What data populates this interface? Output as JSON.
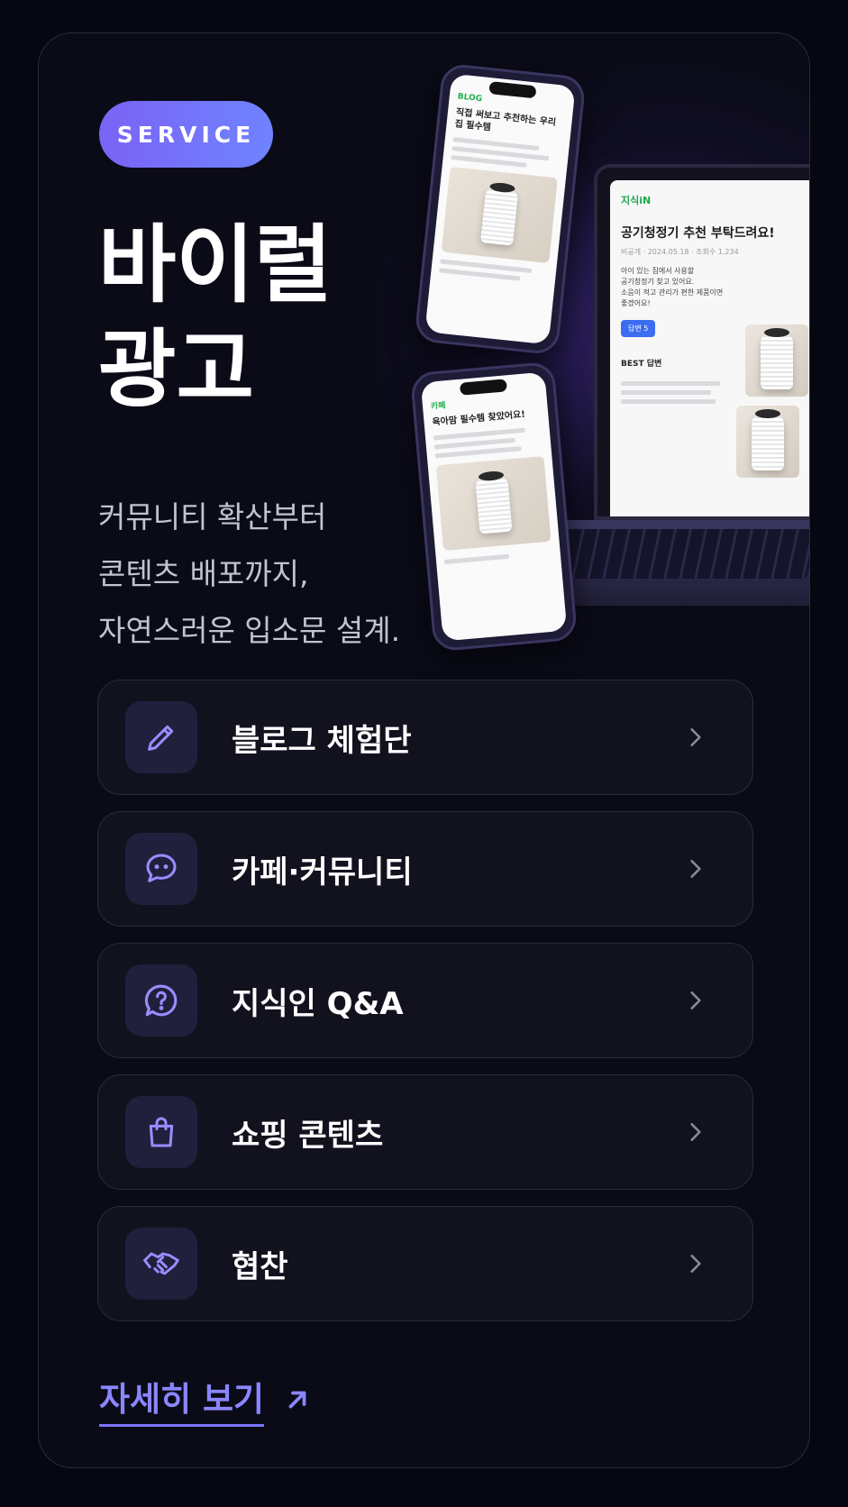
{
  "badge": "SERVICE",
  "title_lines": [
    "바이럴",
    "광고"
  ],
  "subtitle_lines": [
    "커뮤니티 확산부터",
    "콘텐츠 배포까지,",
    "자연스러운 입소문 설계."
  ],
  "illustration": {
    "phone_top": {
      "brand": "BLOG",
      "headline": "직접 써보고 추천하는 우리집 필수템"
    },
    "phone_bottom": {
      "brand": "카페",
      "headline": "육아맘 필수템 찾았어요!"
    },
    "laptop": {
      "brand": "지식iN",
      "question": "공기청정기 추천 부탁드려요!",
      "meta": "비공개 · 2024.05.18 · 조회수 1,234",
      "body_lines": [
        "아이 있는 집에서 사용할",
        "공기청정기 찾고 있어요.",
        "소음이 적고 관리가 편한 제품이면",
        "좋겠어요!"
      ],
      "answers_button": "답변 5",
      "best_answer_label": "BEST 답변"
    }
  },
  "services": [
    {
      "label": "블로그 체험단",
      "icon": "pencil-icon"
    },
    {
      "label": "카페·커뮤니티",
      "icon": "chat-bubble-icon"
    },
    {
      "label": "지식인 Q&A",
      "icon": "question-icon"
    },
    {
      "label": "쇼핑 콘텐츠",
      "icon": "shopping-bag-icon"
    },
    {
      "label": "협찬",
      "icon": "handshake-icon"
    }
  ],
  "more_link": "자세히 보기",
  "colors": {
    "accent": "#8a86ff",
    "badge_gradient_start": "#7a63f5",
    "badge_gradient_end": "#6f83ff",
    "background": "#0b0b18"
  }
}
